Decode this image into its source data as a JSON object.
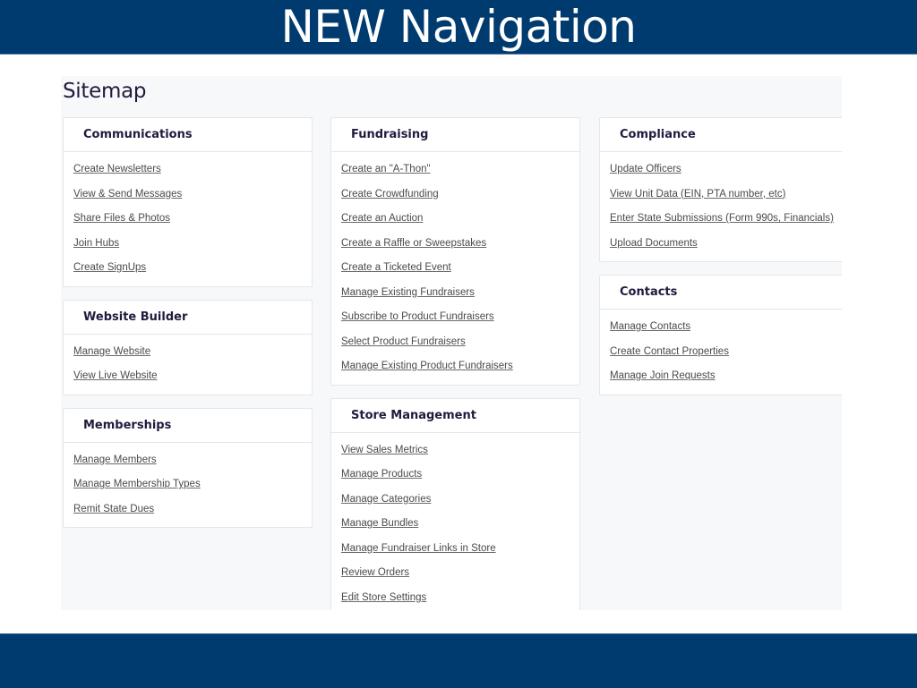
{
  "slide": {
    "title": "NEW Navigation"
  },
  "sitemap": {
    "title": "Sitemap",
    "columns": [
      {
        "sections": [
          {
            "title": "Communications",
            "links": [
              "Create Newsletters",
              "View & Send Messages",
              "Share Files & Photos",
              "Join Hubs",
              "Create SignUps"
            ]
          },
          {
            "title": "Website Builder",
            "links": [
              "Manage Website",
              "View Live Website"
            ]
          },
          {
            "title": "Memberships",
            "links": [
              "Manage Members",
              "Manage Membership Types",
              "Remit State Dues"
            ]
          }
        ]
      },
      {
        "sections": [
          {
            "title": "Fundraising",
            "links": [
              "Create an \"A-Thon\"",
              "Create Crowdfunding",
              "Create an Auction",
              "Create a Raffle or Sweepstakes",
              "Create a Ticketed Event",
              "Manage Existing Fundraisers",
              "Subscribe to Product Fundraisers",
              "Select Product Fundraisers",
              "Manage Existing Product Fundraisers"
            ]
          },
          {
            "title": "Store Management",
            "links": [
              "View Sales Metrics",
              "Manage Products",
              "Manage Categories",
              "Manage Bundles",
              "Manage Fundraiser Links in Store",
              "Review Orders",
              "Edit Store Settings"
            ]
          }
        ]
      },
      {
        "sections": [
          {
            "title": "Compliance",
            "links": [
              "Update Officers",
              "View Unit Data (EIN, PTA number, etc)",
              "Enter State Submissions (Form 990s, Financials)",
              "Upload Documents"
            ]
          },
          {
            "title": "Contacts",
            "links": [
              "Manage Contacts",
              "Create Contact Properties",
              "Manage Join Requests"
            ]
          }
        ]
      }
    ]
  },
  "colors": {
    "banner": "#003b70",
    "heading": "#221a3d",
    "link": "#4a4a4a"
  }
}
